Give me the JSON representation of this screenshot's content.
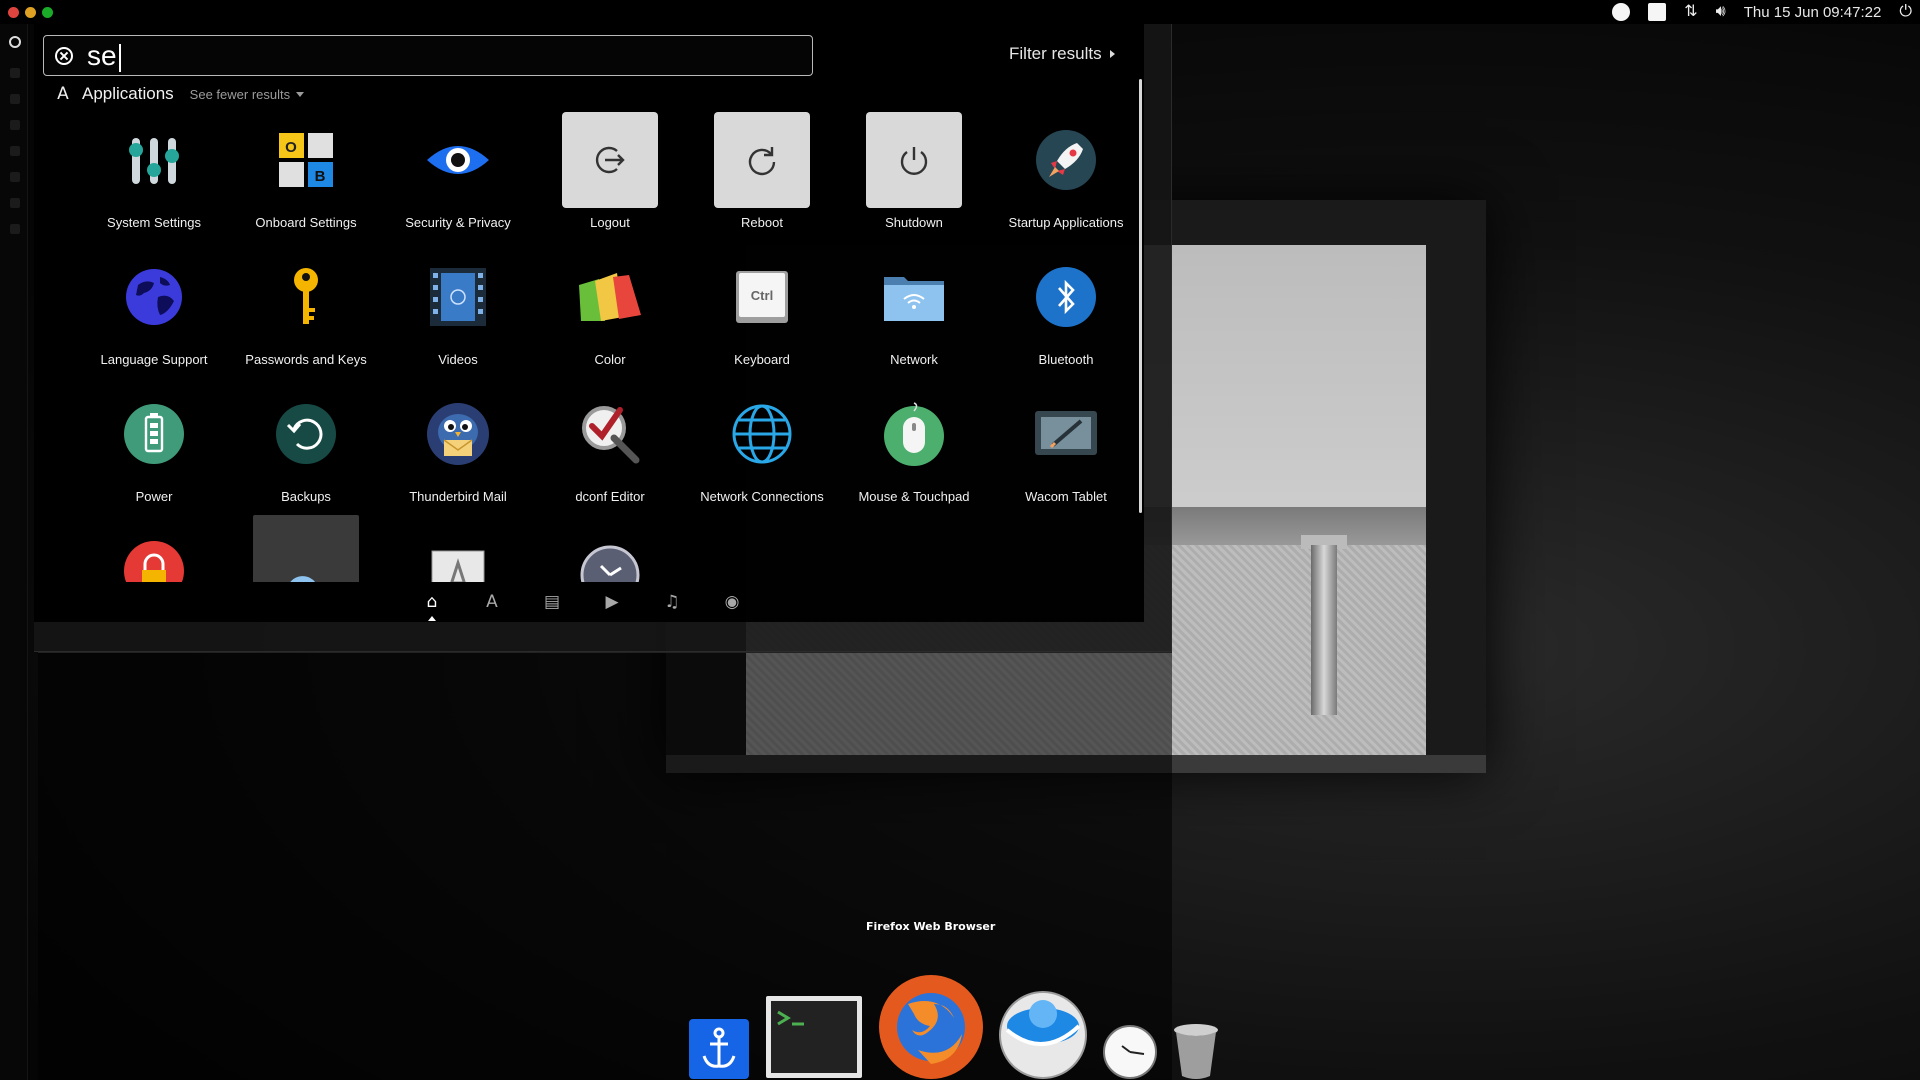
{
  "top_panel": {
    "datetime": "Thu 15 Jun 09:47:22",
    "window_buttons": [
      "close",
      "minimize",
      "maximize"
    ],
    "colors": {
      "close": "#e0443e",
      "minimize": "#dea123",
      "maximize": "#1aab29"
    },
    "indicators": [
      "record-indicator-icon",
      "screen-indicator-icon",
      "network-icon",
      "volume-icon",
      "power-icon"
    ]
  },
  "dash": {
    "search": {
      "query": "se"
    },
    "filter_results_label": "Filter results",
    "category": {
      "title": "Applications",
      "see_fewer_label": "See fewer results"
    },
    "apps": [
      {
        "label": "System Settings",
        "icon": "system-settings-icon"
      },
      {
        "label": "Onboard Settings",
        "icon": "onboard-settings-icon"
      },
      {
        "label": "Security & Privacy",
        "icon": "security-privacy-icon"
      },
      {
        "label": "Logout",
        "icon": "logout-icon"
      },
      {
        "label": "Reboot",
        "icon": "reboot-icon"
      },
      {
        "label": "Shutdown",
        "icon": "shutdown-icon"
      },
      {
        "label": "Startup Applications",
        "icon": "startup-applications-icon"
      },
      {
        "label": "Language Support",
        "icon": "language-support-icon"
      },
      {
        "label": "Passwords and Keys",
        "icon": "passwords-keys-icon"
      },
      {
        "label": "Videos",
        "icon": "videos-icon"
      },
      {
        "label": "Color",
        "icon": "color-icon"
      },
      {
        "label": "Keyboard",
        "icon": "keyboard-icon"
      },
      {
        "label": "Network",
        "icon": "network-folder-icon"
      },
      {
        "label": "Bluetooth",
        "icon": "bluetooth-icon"
      },
      {
        "label": "Power",
        "icon": "power-battery-icon"
      },
      {
        "label": "Backups",
        "icon": "backups-icon"
      },
      {
        "label": "Thunderbird Mail",
        "icon": "thunderbird-icon"
      },
      {
        "label": "dconf Editor",
        "icon": "dconf-editor-icon"
      },
      {
        "label": "Network Connections",
        "icon": "network-connections-icon"
      },
      {
        "label": "Mouse & Touchpad",
        "icon": "mouse-touchpad-icon"
      },
      {
        "label": "Wacom Tablet",
        "icon": "wacom-tablet-icon"
      }
    ],
    "partial_row_icons": [
      "lock-icon",
      "cloud-icon",
      "font-icon",
      "clock-icon"
    ],
    "keyboard_icon_text": "Ctrl",
    "onboard_letters": [
      "O",
      "B"
    ],
    "lenses": [
      {
        "name": "home-lens-icon",
        "glyph": "⌂",
        "active": true
      },
      {
        "name": "applications-lens-icon",
        "glyph": "A",
        "active": false
      },
      {
        "name": "files-lens-icon",
        "glyph": "▤",
        "active": false
      },
      {
        "name": "video-lens-icon",
        "glyph": "▶",
        "active": false
      },
      {
        "name": "music-lens-icon",
        "glyph": "♫",
        "active": false
      },
      {
        "name": "photos-lens-icon",
        "glyph": "◉",
        "active": false
      }
    ]
  },
  "dock": {
    "tooltip": "Firefox Web Browser",
    "items": [
      "anchor-app-icon",
      "terminal-icon",
      "firefox-icon",
      "browser-globe-icon",
      "clock-app-icon",
      "trash-icon"
    ]
  }
}
